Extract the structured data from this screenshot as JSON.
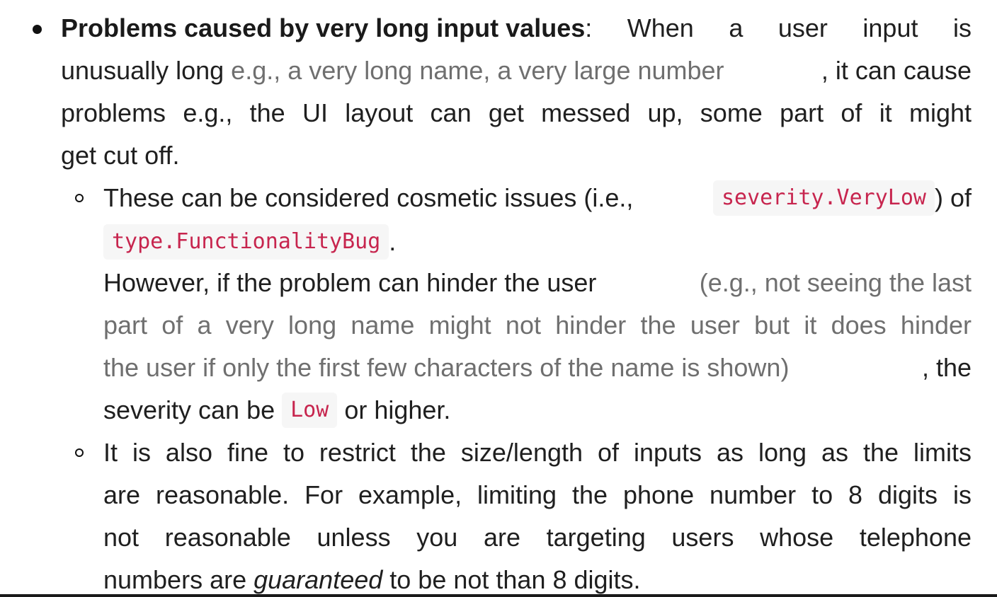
{
  "bullet1": {
    "lead_bold": "Problems caused by very long input values",
    "line1_rest": ": When a user input is",
    "line2_a": "unusually long ",
    "line2_gray": "e.g., a very long name, a very large number",
    "line2_b": ", it can cause",
    "line3": "problems e.g., the UI layout can get messed up, some part of it might",
    "line4": "get cut off."
  },
  "sub1": {
    "line1_a": "These can be considered cosmetic issues (i.e., ",
    "code1": "severity.VeryLow",
    "line1_b": ") of",
    "code2": "type.FunctionalityBug",
    "line2_tail": ".",
    "line3_a": "However, if the problem can hinder the user ",
    "line3_gray": "(e.g., not seeing the last",
    "line4_gray": "part of a very long name might not hinder the user but it does hinder",
    "line5_gray": "the user if only the first few characters of the name is shown)",
    "line5_b": ", the",
    "line6_a": "severity can be ",
    "code3": "Low",
    "line6_b": " or higher."
  },
  "sub2": {
    "line1": "It is also fine to restrict the size/length of inputs as long as the limits",
    "line2": "are reasonable. For example, limiting the phone number to 8 digits is",
    "line3": "not reasonable unless you are targeting users whose telephone",
    "line4_a": "numbers are ",
    "line4_em": "guaranteed",
    "line4_b": " to be not than 8 digits."
  }
}
